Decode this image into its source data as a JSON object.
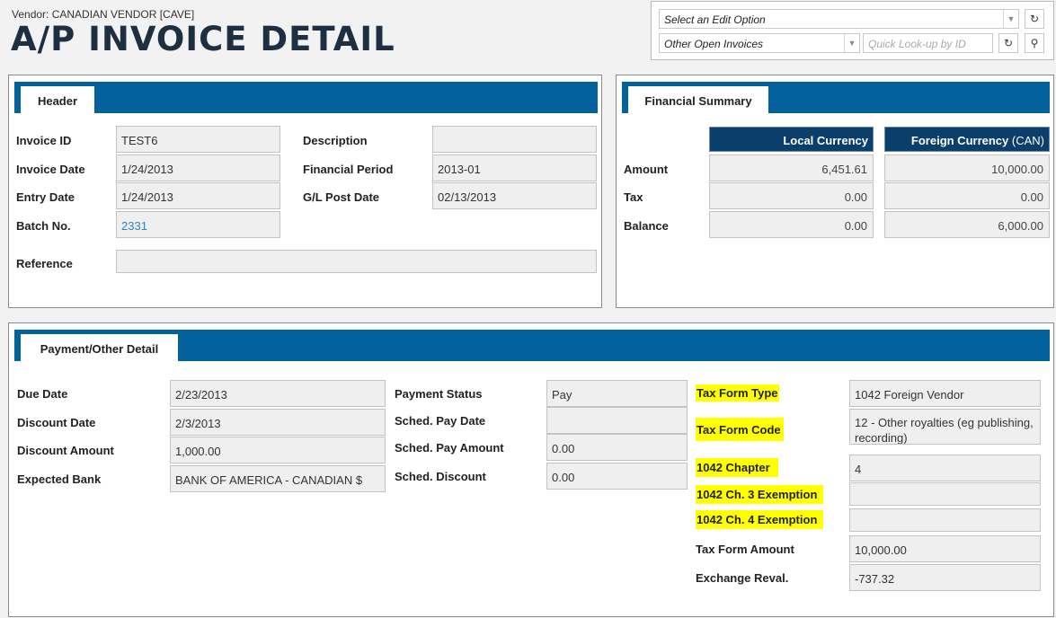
{
  "header": {
    "vendor": "Vendor: CANADIAN VENDOR [CAVE]",
    "title": "A/P INVOICE DETAIL"
  },
  "edit_controls": {
    "edit_option_placeholder": "Select an Edit Option",
    "other_invoices_value": "Other Open Invoices",
    "quick_lookup_placeholder": "Quick Look-up by ID"
  },
  "header_panel": {
    "tab": "Header",
    "invoice_id_label": "Invoice ID",
    "invoice_id": "TEST6",
    "invoice_date_label": "Invoice Date",
    "invoice_date": "1/24/2013",
    "entry_date_label": "Entry Date",
    "entry_date": "1/24/2013",
    "batch_no_label": "Batch No.",
    "batch_no": "2331",
    "reference_label": "Reference",
    "reference": "",
    "description_label": "Description",
    "description": "",
    "financial_period_label": "Financial Period",
    "financial_period": "2013-01",
    "gl_post_date_label": "G/L Post Date",
    "gl_post_date": "02/13/2013"
  },
  "financial_summary": {
    "tab": "Financial Summary",
    "local_currency_header": "Local Currency",
    "foreign_currency_header": "Foreign Currency",
    "foreign_currency_code": "(CAN)",
    "amount_label": "Amount",
    "tax_label": "Tax",
    "balance_label": "Balance",
    "local_amount": "6,451.61",
    "local_tax": "0.00",
    "local_balance": "0.00",
    "foreign_amount": "10,000.00",
    "foreign_tax": "0.00",
    "foreign_balance": "6,000.00"
  },
  "payment_panel": {
    "tab": "Payment/Other Detail",
    "due_date_label": "Due Date",
    "due_date": "2/23/2013",
    "discount_date_label": "Discount Date",
    "discount_date": "2/3/2013",
    "discount_amount_label": "Discount Amount",
    "discount_amount": "1,000.00",
    "expected_bank_label": "Expected Bank",
    "expected_bank": "BANK OF AMERICA - CANADIAN $",
    "payment_status_label": "Payment Status",
    "payment_status": "Pay",
    "sched_pay_date_label": "Sched. Pay Date",
    "sched_pay_date": "",
    "sched_pay_amount_label": "Sched. Pay Amount",
    "sched_pay_amount": "0.00",
    "sched_discount_label": "Sched. Discount",
    "sched_discount": "0.00",
    "tax_form_type_label": "Tax Form Type",
    "tax_form_type": "1042 Foreign Vendor",
    "tax_form_code_label": "Tax Form Code",
    "tax_form_code": "12 - Other royalties (eg publishing, recording)",
    "chapter_label": "1042 Chapter",
    "chapter": "4",
    "ch3_exemption_label": "1042 Ch. 3 Exemption",
    "ch3_exemption": "",
    "ch4_exemption_label": "1042 Ch. 4 Exemption",
    "ch4_exemption": "",
    "tax_form_amount_label": "Tax Form Amount",
    "tax_form_amount": "10,000.00",
    "exchange_reval_label": "Exchange Reval.",
    "exchange_reval": "-737.32"
  },
  "colors": {
    "band": "#03619c",
    "column_header": "#0a3e6b",
    "highlight": "#ffff00",
    "link": "#2a86c9"
  }
}
